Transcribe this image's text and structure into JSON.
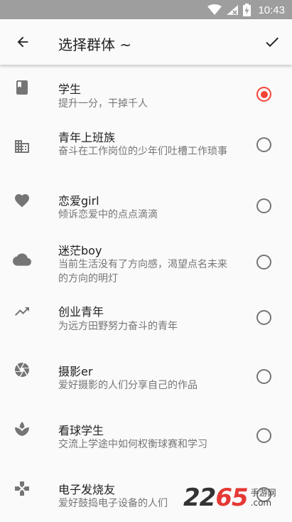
{
  "status_bar": {
    "time": "10:43"
  },
  "app_bar": {
    "title": "选择群体 ~"
  },
  "colors": {
    "accent": "#f44336",
    "icon": "#757575",
    "title_text": "#212121",
    "secondary_text": "#757575"
  },
  "groups": [
    {
      "icon": "book-icon",
      "title": "学生",
      "desc": "提升一分，干掉千人",
      "selected": true
    },
    {
      "icon": "building-icon",
      "title": "青年上班族",
      "desc": "奋斗在工作岗位的少年们吐槽工作琐事",
      "selected": false
    },
    {
      "icon": "heart-icon",
      "title": "恋爱girl",
      "desc": "倾诉恋爱中的点点滴滴",
      "selected": false
    },
    {
      "icon": "cloud-icon",
      "title": "迷茫boy",
      "desc": "当前生活没有了方向感，渴望点名未来的方向的明灯",
      "selected": false
    },
    {
      "icon": "trending-up-icon",
      "title": "创业青年",
      "desc": "为远方田野努力奋斗的青年",
      "selected": false
    },
    {
      "icon": "camera-shutter-icon",
      "title": "摄影er",
      "desc": "爱好摄影的人们分享自己的作品",
      "selected": false
    },
    {
      "icon": "spa-icon",
      "title": "看球学生",
      "desc": "交流上学途中如何权衡球赛和学习",
      "selected": false
    },
    {
      "icon": "gamepad-icon",
      "title": "电子发烧友",
      "desc": "爱好鼓捣电子设备的人们",
      "selected": false
    }
  ],
  "watermark": {
    "digits_main": "22",
    "digits_accent": "65",
    "site": "手游网",
    "domain": ".com"
  }
}
